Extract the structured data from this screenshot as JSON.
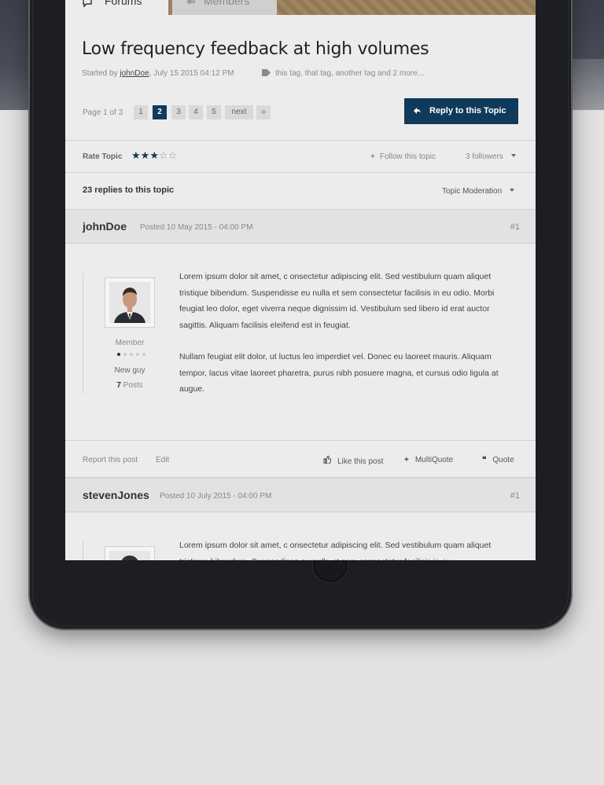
{
  "tabs": {
    "forums": "Forums",
    "members": "Members"
  },
  "topic": {
    "title": "Low frequency feedback at high volumes",
    "started_by_prefix": "Started by",
    "author": "johnDoe",
    "date": ", July 15 2015 04:12 PM",
    "tags": "this tag, that tag, another tag and 2 more..."
  },
  "pagination": {
    "page_of": "Page 1 of 3",
    "pages": [
      "1",
      "2",
      "3",
      "4",
      "5"
    ],
    "active_page": "2",
    "next": "next",
    "last": "»"
  },
  "reply_button": "Reply to this Topic",
  "rating": {
    "label": "Rate Topic",
    "stars": 3,
    "max_stars": 5
  },
  "follow": {
    "label": "Follow this topic",
    "followers": "3 followers"
  },
  "replies_count": "23 replies to this topic",
  "moderation": "Topic Moderation",
  "posts": [
    {
      "username": "johnDoe",
      "posted": "Posted 10 May 2015 - 04:00 PM",
      "number": "#1",
      "role": "Member",
      "rank": "New guy",
      "post_count": "7",
      "post_count_label": "Posts",
      "body": [
        "Lorem ipsum dolor sit amet, c onsectetur adipiscing elit. Sed vestibulum quam aliquet tristique bibendum. Suspendisse eu nulla et sem consectetur facilisis in eu odio. Morbi feugiat leo dolor, eget viverra neque dignissim id. Vestibulum sed libero id erat auctor sagittis. Aliquam facilisis eleifend est in feugiat.",
        "Nullam feugiat elit dolor, ut luctus leo imperdiet vel. Donec eu laoreet mauris. Aliquam tempor, lacus vitae laoreet pharetra, purus nibh posuere magna, et cursus odio ligula at augue."
      ],
      "footer": {
        "report": "Report this post",
        "edit": "Edit",
        "like": "Like this post",
        "multiquote": "MultiQuote",
        "quote": "Quote"
      }
    },
    {
      "username": "stevenJones",
      "posted": "Posted 10 July 2015 - 04:00 PM",
      "number": "#1",
      "body": [
        "Lorem ipsum dolor sit amet, c onsectetur adipiscing elit. Sed vestibulum quam aliquet tristique bibendum. Suspendisse eu nulla et sem consectetur facilisis in eu"
      ]
    }
  ],
  "colors": {
    "accent": "#0f3a5a",
    "tab_bar": "#9c8161"
  }
}
